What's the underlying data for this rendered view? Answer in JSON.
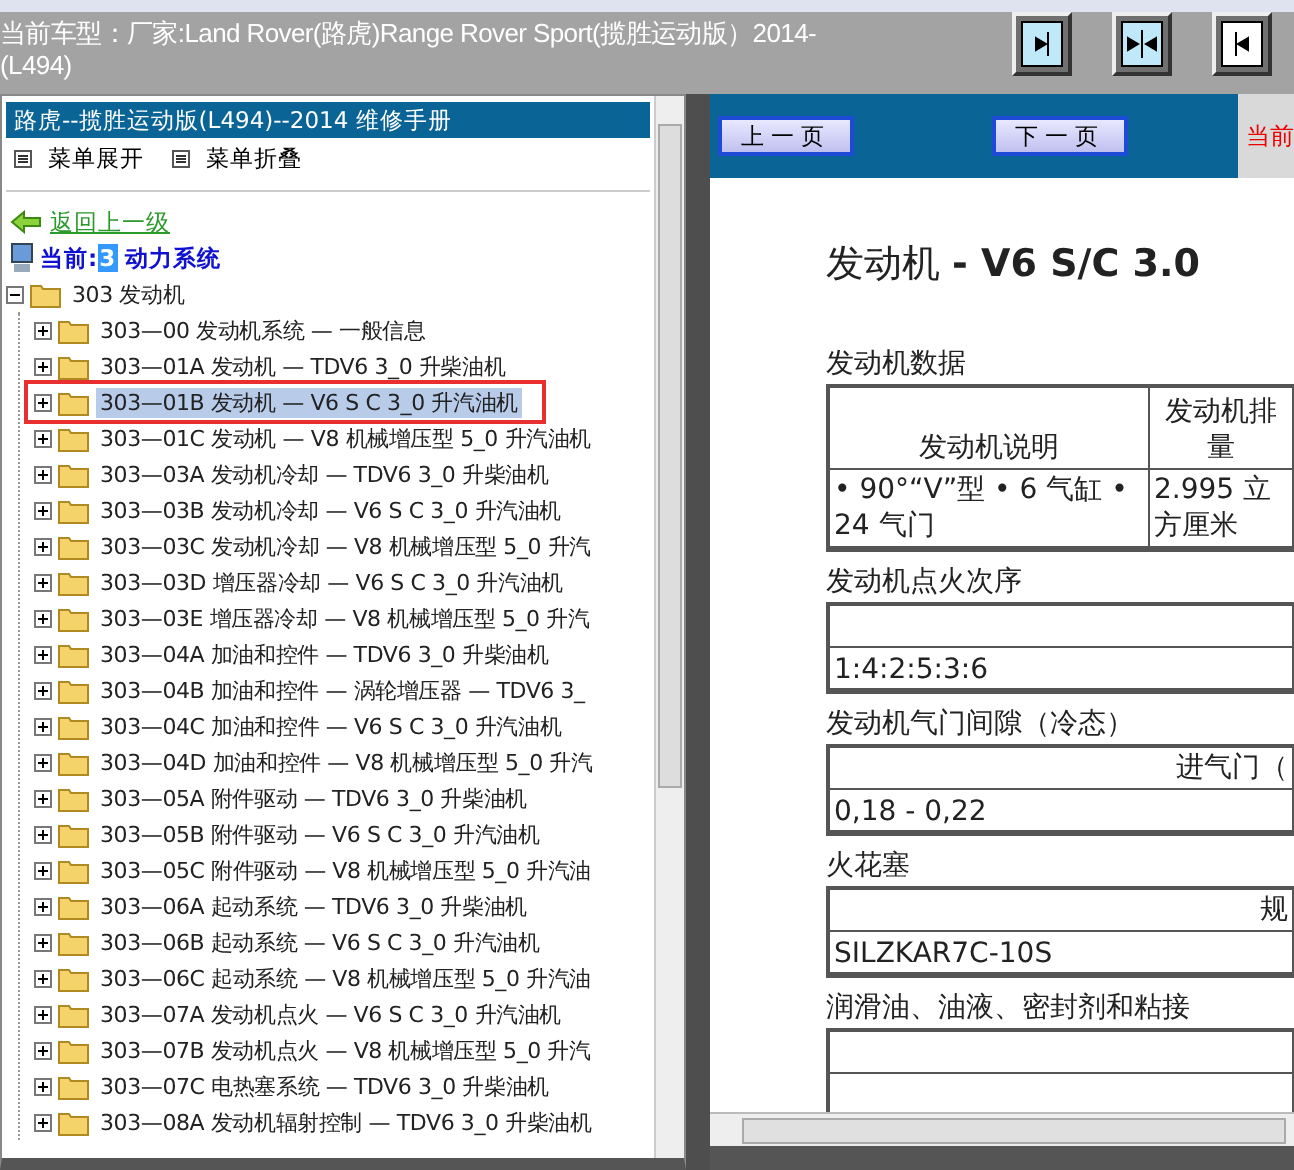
{
  "header": {
    "title": "当前车型：厂家:Land Rover(路虎)Range Rover Sport(揽胜运动版）2014-(L494)",
    "layout_buttons": [
      {
        "kind": "arrow-right"
      },
      {
        "kind": "arrows-inward"
      },
      {
        "kind": "arrow-left"
      }
    ]
  },
  "sidebar": {
    "title": "路虎--揽胜运动版(L494)--2014 维修手册",
    "menu_actions": [
      "菜单展开",
      "菜单折叠"
    ],
    "back_link": "返回上一级",
    "current": {
      "label": "当前:",
      "value": "3",
      "name": "动力系统"
    },
    "tree": [
      {
        "label": "303 发动机",
        "expanded": true,
        "children": [
          {
            "label": "303—00 发动机系统 — 一般信息",
            "expanded": false,
            "selected": false,
            "outlined": false
          },
          {
            "label": "303—01A 发动机 — TDV6 3_0 升柴油机",
            "expanded": false,
            "selected": false,
            "outlined": false
          },
          {
            "label": "303—01B 发动机 — V6 S C 3_0 升汽油机",
            "expanded": false,
            "selected": true,
            "outlined": true
          },
          {
            "label": "303—01C 发动机 — V8 机械增压型 5_0 升汽油机",
            "expanded": false,
            "selected": false,
            "outlined": false
          },
          {
            "label": "303—03A 发动机冷却 — TDV6 3_0 升柴油机",
            "expanded": false,
            "selected": false,
            "outlined": false
          },
          {
            "label": "303—03B 发动机冷却 — V6 S C 3_0 升汽油机",
            "expanded": false,
            "selected": false,
            "outlined": false
          },
          {
            "label": "303—03C 发动机冷却 — V8 机械增压型 5_0 升汽",
            "expanded": false,
            "selected": false,
            "outlined": false
          },
          {
            "label": "303—03D 增压器冷却 — V6 S C 3_0 升汽油机",
            "expanded": false,
            "selected": false,
            "outlined": false
          },
          {
            "label": "303—03E 增压器冷却 — V8 机械增压型 5_0 升汽",
            "expanded": false,
            "selected": false,
            "outlined": false
          },
          {
            "label": "303—04A 加油和控件 — TDV6 3_0 升柴油机",
            "expanded": false,
            "selected": false,
            "outlined": false
          },
          {
            "label": "303—04B 加油和控件 — 涡轮增压器 — TDV6 3_",
            "expanded": false,
            "selected": false,
            "outlined": false
          },
          {
            "label": "303—04C 加油和控件 — V6 S C 3_0 升汽油机",
            "expanded": false,
            "selected": false,
            "outlined": false
          },
          {
            "label": "303—04D 加油和控件 — V8 机械增压型 5_0 升汽",
            "expanded": false,
            "selected": false,
            "outlined": false
          },
          {
            "label": "303—05A 附件驱动 — TDV6 3_0 升柴油机",
            "expanded": false,
            "selected": false,
            "outlined": false
          },
          {
            "label": "303—05B 附件驱动 — V6 S C 3_0 升汽油机",
            "expanded": false,
            "selected": false,
            "outlined": false
          },
          {
            "label": "303—05C 附件驱动 — V8 机械增压型 5_0 升汽油",
            "expanded": false,
            "selected": false,
            "outlined": false
          },
          {
            "label": "303—06A 起动系统 — TDV6 3_0 升柴油机",
            "expanded": false,
            "selected": false,
            "outlined": false
          },
          {
            "label": "303—06B 起动系统 — V6 S C 3_0 升汽油机",
            "expanded": false,
            "selected": false,
            "outlined": false
          },
          {
            "label": "303—06C 起动系统 — V8 机械增压型 5_0 升汽油",
            "expanded": false,
            "selected": false,
            "outlined": false
          },
          {
            "label": "303—07A 发动机点火 — V6 S C 3_0 升汽油机",
            "expanded": false,
            "selected": false,
            "outlined": false
          },
          {
            "label": "303—07B 发动机点火 — V8 机械增压型 5_0 升汽",
            "expanded": false,
            "selected": false,
            "outlined": false
          },
          {
            "label": "303—07C 电热塞系统 — TDV6 3_0 升柴油机",
            "expanded": false,
            "selected": false,
            "outlined": false
          },
          {
            "label": "303—08A 发动机辐射控制 — TDV6 3_0 升柴油机",
            "expanded": false,
            "selected": false,
            "outlined": false
          }
        ]
      }
    ]
  },
  "nav": {
    "prev": "上一页",
    "next": "下一页",
    "page_label": "当前"
  },
  "document": {
    "title": "发动机 **- V6 S/C 3.0**",
    "sections": [
      {
        "heading": "发动机数据",
        "kind": "grid",
        "columns": [
          "发动机说明",
          "发动机排量"
        ],
        "values": [
          "• 90°“V”型 • 6 气缸 • 24 气门",
          "2.995 立方厘米"
        ]
      },
      {
        "heading": "发动机点火次序",
        "kind": "single",
        "value": "1:4:2:5:3:6"
      },
      {
        "heading": "发动机气门间隙（冷态）",
        "kind": "single",
        "column": "进气门（",
        "value": "0,18 - 0,22"
      },
      {
        "heading": "火花塞",
        "kind": "single",
        "column": "规",
        "value": "SILZKAR7C-10S"
      },
      {
        "heading": "润滑油、油液、密封剂和粘接",
        "kind": "single"
      }
    ]
  }
}
